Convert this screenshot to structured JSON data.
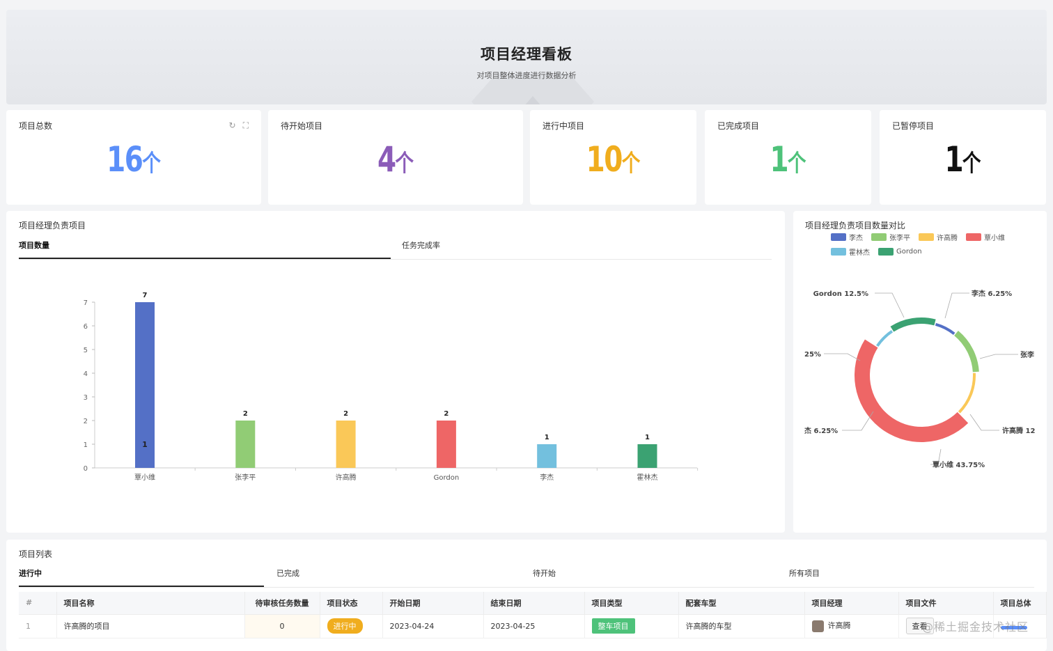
{
  "header": {
    "title": "项目经理看板",
    "subtitle": "对项目整体进度进行数据分析"
  },
  "stats": [
    {
      "label": "项目总数",
      "value": "16",
      "unit": "个",
      "color": "#5b8ff9"
    },
    {
      "label": "待开始项目",
      "value": "4",
      "unit": "个",
      "color": "#8b5cb8"
    },
    {
      "label": "进行中项目",
      "value": "10",
      "unit": "个",
      "color": "#f0ad1e"
    },
    {
      "label": "已完成项目",
      "value": "1",
      "unit": "个",
      "color": "#4ec27a"
    },
    {
      "label": "已暂停项目",
      "value": "1",
      "unit": "个",
      "color": "#111111"
    }
  ],
  "bar_panel": {
    "title": "项目经理负责项目",
    "tabs": [
      "项目数量",
      "任务完成率"
    ]
  },
  "pie_panel": {
    "title": "项目经理负责项目数量对比",
    "labels": [
      "Gordon 12.5%",
      "李杰 6.25%",
      "张李",
      "25%",
      "杰 6.25%",
      "许高腾 12",
      "覃小维 43.75%"
    ]
  },
  "table_panel": {
    "title": "项目列表",
    "tabs": [
      "进行中",
      "已完成",
      "待开始",
      "所有项目"
    ],
    "columns": [
      "#",
      "项目名称",
      "待审核任务数量",
      "项目状态",
      "开始日期",
      "结束日期",
      "项目类型",
      "配套车型",
      "项目经理",
      "项目文件",
      "项目总体"
    ],
    "rows": [
      {
        "index": "1",
        "name": "许高腾的项目",
        "pending": "0",
        "status": "进行中",
        "start": "2023-04-24",
        "end": "2023-04-25",
        "type": "整车项目",
        "model": "许高腾的车型",
        "manager": "许高腾",
        "file": "查看"
      }
    ]
  },
  "watermark": "@稀土掘金技术社区",
  "chart_data": [
    {
      "type": "bar",
      "categories": [
        "覃小维",
        "张李平",
        "许高腾",
        "Gordon",
        "李杰",
        "霍林杰"
      ],
      "values": [
        7,
        2,
        2,
        2,
        1,
        1
      ],
      "colors": [
        "#5470c6",
        "#91cc75",
        "#fac858",
        "#ee6666",
        "#73c0de",
        "#3ba272"
      ],
      "ylim": [
        0,
        7
      ],
      "yticks": [
        0,
        1,
        2,
        3,
        4,
        5,
        6,
        7
      ],
      "annotation": "1"
    },
    {
      "type": "pie",
      "legend": [
        "李杰",
        "张李平",
        "许高腾",
        "覃小维",
        "霍林杰",
        "Gordon"
      ],
      "colors": [
        "#5470c6",
        "#91cc75",
        "#fac858",
        "#ee6666",
        "#73c0de",
        "#3ba272"
      ],
      "values": [
        6.25,
        12.5,
        12.5,
        43.75,
        6.25,
        12.5
      ]
    }
  ]
}
